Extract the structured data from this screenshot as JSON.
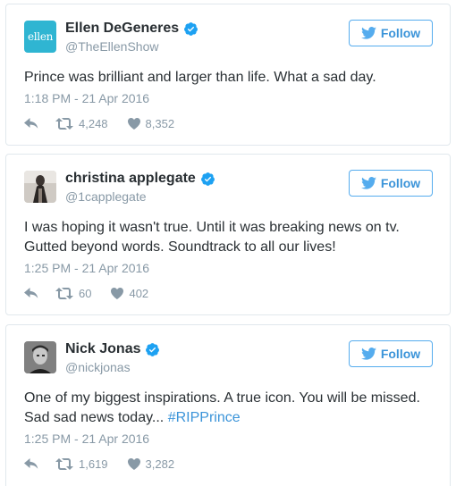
{
  "colors": {
    "accent": "#3b94d9",
    "verified": "#1da1f2",
    "muted": "#8899a6",
    "text": "#292f33",
    "ellen_avatar": "#2fb5d2"
  },
  "follow_label": "Follow",
  "tweets": [
    {
      "avatar_text": "ellen",
      "name": "Ellen DeGeneres",
      "handle": "@TheEllenShow",
      "text_line1": "Prince was brilliant and larger than life. What a sad day.",
      "timestamp": "1:18 PM - 21 Apr 2016",
      "retweets": "4,248",
      "likes": "8,352"
    },
    {
      "name": "christina applegate",
      "handle": "@1capplegate",
      "text_line1": "I was hoping it wasn't true. Until it was breaking news on tv.",
      "text_line2": "Gutted beyond words. Soundtrack to all our lives!",
      "timestamp": "1:25 PM - 21 Apr 2016",
      "retweets": "60",
      "likes": "402"
    },
    {
      "name": "Nick Jonas",
      "handle": "@nickjonas",
      "text_line1": "One of my biggest inspirations. A true icon. You will be missed.",
      "text_line2": "Sad sad news today...",
      "hashtag": "#RIPPrince",
      "timestamp": "1:25 PM - 21 Apr 2016",
      "retweets": "1,619",
      "likes": "3,282"
    }
  ]
}
